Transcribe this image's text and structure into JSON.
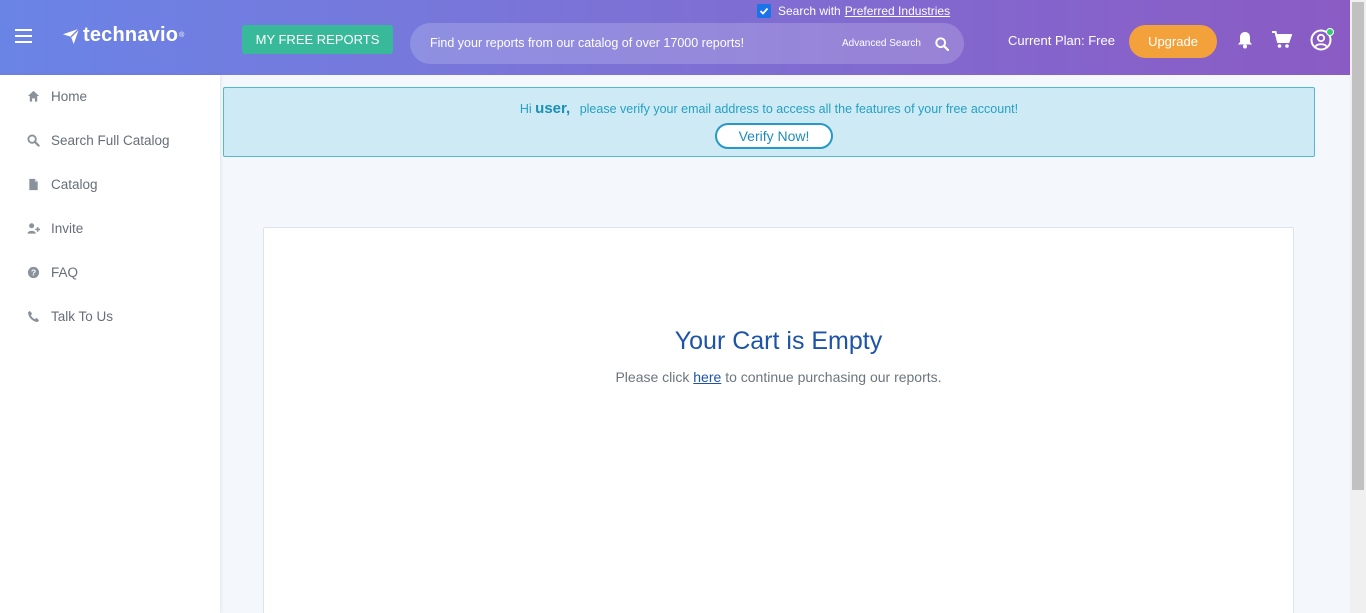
{
  "header": {
    "logo_text": "technavio",
    "logo_tm": "®",
    "free_reports_label": "MY FREE REPORTS",
    "search_placeholder": "Find your reports from our catalog of over 17000 reports!",
    "advanced_search_label": "Advanced Search",
    "preferred_prefix": "Search with",
    "preferred_link": "Preferred Industries",
    "preferred_checked": true,
    "current_plan": "Current Plan: Free",
    "upgrade_label": "Upgrade",
    "icons": [
      "menu-icon",
      "bell-icon",
      "cart-icon",
      "user-icon"
    ],
    "colors": {
      "gradient_start": "#6a84e6",
      "gradient_end": "#8a5bc4",
      "free_reports_bg": "#37b99a",
      "upgrade_bg": "#f3a23b"
    }
  },
  "sidebar": {
    "items": [
      {
        "label": "Home",
        "icon": "home-icon"
      },
      {
        "label": "Search Full Catalog",
        "icon": "search-icon"
      },
      {
        "label": "Catalog",
        "icon": "file-icon"
      },
      {
        "label": "Invite",
        "icon": "user-plus-icon"
      },
      {
        "label": "FAQ",
        "icon": "question-icon"
      },
      {
        "label": "Talk To Us",
        "icon": "phone-icon"
      }
    ]
  },
  "alert": {
    "hi": "Hi",
    "user": "user,",
    "message": "please verify your email address to access all the features of your free account!",
    "verify_label": "Verify Now!"
  },
  "cart": {
    "title": "Your Cart is Empty",
    "sub_before": "Please click",
    "link": "here",
    "sub_after": "to continue purchasing our reports."
  }
}
